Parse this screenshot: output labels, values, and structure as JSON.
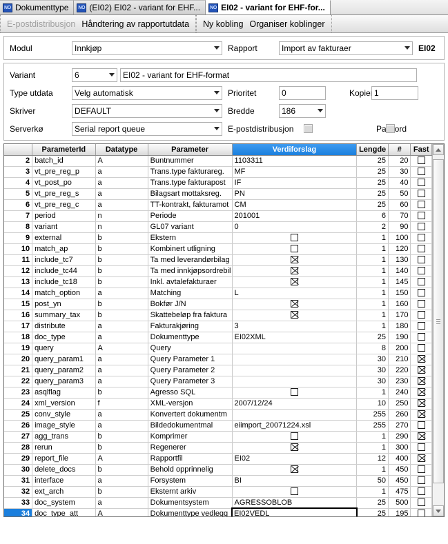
{
  "window": {
    "tabs": [
      {
        "icon": "no-icon",
        "label": "Dokumenttype",
        "active": false
      },
      {
        "icon": "no-icon",
        "label": "(EI02) EI02 - variant for EHF...",
        "active": false
      },
      {
        "icon": "no-icon",
        "label": "EI02 - variant for EHF-for...",
        "active": true
      }
    ]
  },
  "menu": {
    "group1": [
      {
        "label": "E-postdistribusjon",
        "disabled": true
      },
      {
        "label": "Håndtering av rapportutdata",
        "disabled": false
      }
    ],
    "group2": [
      {
        "label": "Ny kobling",
        "disabled": false
      },
      {
        "label": "Organiser koblinger",
        "disabled": false
      }
    ]
  },
  "form": {
    "modul_label": "Modul",
    "modul_value": "Innkjøp",
    "rapport_label": "Rapport",
    "rapport_value": "Import av fakturaer",
    "rapport_code": "EI02",
    "variant_label": "Variant",
    "variant_number": "6",
    "variant_name": "EI02 - variant for EHF-format",
    "type_utdata_label": "Type utdata",
    "type_utdata_value": "Velg automatisk",
    "prioritet_label": "Prioritet",
    "prioritet_value": "0",
    "kopier_label": "Kopier",
    "kopier_value": "1",
    "skriver_label": "Skriver",
    "skriver_value": "DEFAULT",
    "bredde_label": "Bredde",
    "bredde_value": "186",
    "serverko_label": "Serverkø",
    "serverko_value": "Serial report queue",
    "epost_label": "E-postdistribusjon",
    "passord_label": "Passord"
  },
  "grid": {
    "columns": [
      "",
      "ParameterId",
      "Datatype",
      "Parameter",
      "Verdiforslag",
      "Lengde",
      "#",
      "Fast"
    ],
    "highlighted_column": "Verdiforslag",
    "rows": [
      {
        "no": "2",
        "id": "batch_id",
        "dt": "A",
        "param": "Buntnummer",
        "val": "1103311",
        "valbox": null,
        "len": "25",
        "num": "20",
        "fast": false
      },
      {
        "no": "3",
        "id": "vt_pre_reg_p",
        "dt": "a",
        "param": "Trans.type fakturareg.",
        "val": "MF",
        "valbox": null,
        "len": "25",
        "num": "30",
        "fast": false
      },
      {
        "no": "4",
        "id": "vt_post_po",
        "dt": "a",
        "param": "Trans.type fakturapost",
        "val": "IF",
        "valbox": null,
        "len": "25",
        "num": "40",
        "fast": false
      },
      {
        "no": "5",
        "id": "vt_pre_reg_s",
        "dt": "a",
        "param": "Bilagsart mottaksreg.",
        "val": "PN",
        "valbox": null,
        "len": "25",
        "num": "50",
        "fast": false
      },
      {
        "no": "6",
        "id": "vt_pre_reg_c",
        "dt": "a",
        "param": "TT-kontrakt, fakturamot",
        "val": "CM",
        "valbox": null,
        "len": "25",
        "num": "60",
        "fast": false
      },
      {
        "no": "7",
        "id": "period",
        "dt": "n",
        "param": "Periode",
        "val": "201001",
        "valbox": null,
        "len": "6",
        "num": "70",
        "fast": false
      },
      {
        "no": "8",
        "id": "variant",
        "dt": "n",
        "param": "GL07 variant",
        "val": "0",
        "valbox": null,
        "len": "2",
        "num": "90",
        "fast": false
      },
      {
        "no": "9",
        "id": "external",
        "dt": "b",
        "param": "Ekstern",
        "val": "",
        "valbox": false,
        "len": "1",
        "num": "100",
        "fast": false
      },
      {
        "no": "10",
        "id": "match_ap",
        "dt": "b",
        "param": "Kombinert utligning",
        "val": "",
        "valbox": false,
        "len": "1",
        "num": "120",
        "fast": false
      },
      {
        "no": "11",
        "id": "include_tc7",
        "dt": "b",
        "param": "Ta med leverandørbilag",
        "val": "",
        "valbox": true,
        "len": "1",
        "num": "130",
        "fast": false
      },
      {
        "no": "12",
        "id": "include_tc44",
        "dt": "b",
        "param": "Ta med innkjøpsordrebil",
        "val": "",
        "valbox": true,
        "len": "1",
        "num": "140",
        "fast": false
      },
      {
        "no": "13",
        "id": "include_tc18",
        "dt": "b",
        "param": "Inkl. avtalefakturaer",
        "val": "",
        "valbox": true,
        "len": "1",
        "num": "145",
        "fast": false
      },
      {
        "no": "14",
        "id": "match_option",
        "dt": "a",
        "param": "Matching",
        "val": "L",
        "valbox": null,
        "len": "1",
        "num": "150",
        "fast": false
      },
      {
        "no": "15",
        "id": "post_yn",
        "dt": "b",
        "param": "Bokfør J/N",
        "val": "",
        "valbox": true,
        "len": "1",
        "num": "160",
        "fast": false
      },
      {
        "no": "16",
        "id": "summary_tax",
        "dt": "b",
        "param": "Skattebeløp fra faktura",
        "val": "",
        "valbox": true,
        "len": "1",
        "num": "170",
        "fast": false
      },
      {
        "no": "17",
        "id": "distribute",
        "dt": "a",
        "param": "Fakturakjøring",
        "val": "3",
        "valbox": null,
        "len": "1",
        "num": "180",
        "fast": false
      },
      {
        "no": "18",
        "id": "doc_type",
        "dt": "a",
        "param": "Dokumenttype",
        "val": "EI02XML",
        "valbox": null,
        "len": "25",
        "num": "190",
        "fast": false
      },
      {
        "no": "19",
        "id": "query",
        "dt": "A",
        "param": "Query",
        "val": "",
        "valbox": null,
        "len": "8",
        "num": "200",
        "fast": false
      },
      {
        "no": "20",
        "id": "query_param1",
        "dt": "a",
        "param": "Query Parameter 1",
        "val": "",
        "valbox": null,
        "len": "30",
        "num": "210",
        "fast": true
      },
      {
        "no": "21",
        "id": "query_param2",
        "dt": "a",
        "param": "Query Parameter 2",
        "val": "",
        "valbox": null,
        "len": "30",
        "num": "220",
        "fast": true
      },
      {
        "no": "22",
        "id": "query_param3",
        "dt": "a",
        "param": "Query Parameter 3",
        "val": "",
        "valbox": null,
        "len": "30",
        "num": "230",
        "fast": true
      },
      {
        "no": "23",
        "id": "asqlflag",
        "dt": "b",
        "param": "Agresso SQL",
        "val": "",
        "valbox": false,
        "len": "1",
        "num": "240",
        "fast": true
      },
      {
        "no": "24",
        "id": "xml_version",
        "dt": "f",
        "param": "XML-versjon",
        "val": "2007/12/24",
        "valbox": null,
        "len": "10",
        "num": "250",
        "fast": true
      },
      {
        "no": "25",
        "id": "conv_style",
        "dt": "a",
        "param": "Konvertert dokumentm",
        "val": "",
        "valbox": null,
        "len": "255",
        "num": "260",
        "fast": true
      },
      {
        "no": "26",
        "id": "image_style",
        "dt": "a",
        "param": "Bildedokumentmal",
        "val": "eiimport_20071224.xsl",
        "valbox": null,
        "len": "255",
        "num": "270",
        "fast": false
      },
      {
        "no": "27",
        "id": "agg_trans",
        "dt": "b",
        "param": "Komprimer",
        "val": "",
        "valbox": false,
        "len": "1",
        "num": "290",
        "fast": true
      },
      {
        "no": "28",
        "id": "rerun",
        "dt": "b",
        "param": "Regenerer",
        "val": "",
        "valbox": true,
        "len": "1",
        "num": "300",
        "fast": false
      },
      {
        "no": "29",
        "id": "report_file",
        "dt": "A",
        "param": "Rapportfil",
        "val": "EI02",
        "valbox": null,
        "len": "12",
        "num": "400",
        "fast": true
      },
      {
        "no": "30",
        "id": "delete_docs",
        "dt": "b",
        "param": "Behold opprinnelig",
        "val": "",
        "valbox": true,
        "len": "1",
        "num": "450",
        "fast": false
      },
      {
        "no": "31",
        "id": "interface",
        "dt": "a",
        "param": "Forsystem",
        "val": "BI",
        "valbox": null,
        "len": "50",
        "num": "450",
        "fast": false
      },
      {
        "no": "32",
        "id": "ext_arch",
        "dt": "b",
        "param": "Eksternt arkiv",
        "val": "",
        "valbox": false,
        "len": "1",
        "num": "475",
        "fast": false
      },
      {
        "no": "33",
        "id": "doc_system",
        "dt": "a",
        "param": "Dokumentsystem",
        "val": "AGRESSOBLOB",
        "valbox": null,
        "len": "25",
        "num": "500",
        "fast": false
      },
      {
        "no": "34",
        "id": "doc_type_att",
        "dt": "A",
        "param": "Dokumenttype vedlegg",
        "val": "EI02VEDL",
        "valbox": null,
        "len": "25",
        "num": "195",
        "fast": false,
        "selected": true,
        "editing": true
      }
    ]
  },
  "colors": {
    "accent": "#1b7fdd",
    "grid_numcol": "#c6c6c6",
    "selection": "#1b7fdd"
  }
}
